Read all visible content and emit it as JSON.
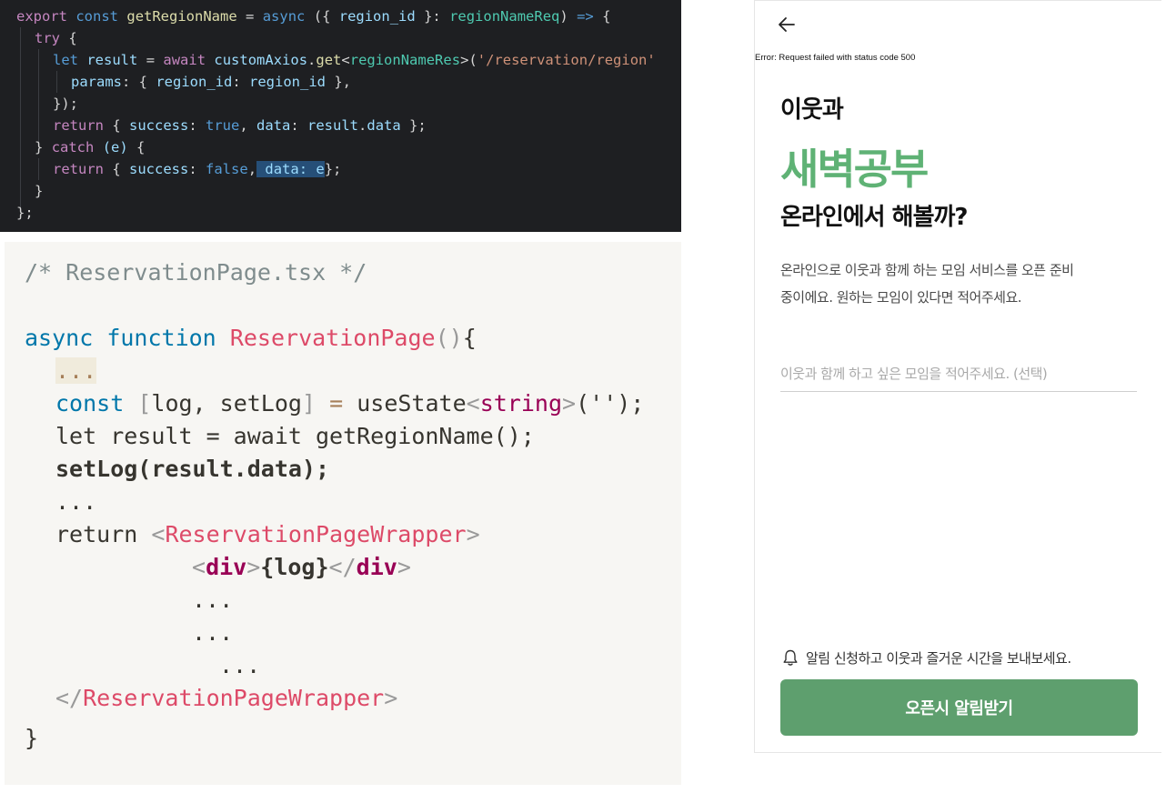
{
  "dark_editor": {
    "line1": {
      "kw_export": "export",
      "kw_const": "const",
      "fn_name": "getRegionName",
      "op_eq": "=",
      "kw_async": "async",
      "paren_open": "({ ",
      "param": "region_id",
      "brace_close": " }: ",
      "type_req": "regionNameReq",
      "paren_close": ")",
      "arrow": "=>",
      "brace": "{"
    },
    "line2": {
      "kw_try": "try",
      "brace": "{"
    },
    "line3": {
      "kw_let": "let",
      "var_result": "result",
      "op_eq": "=",
      "kw_await": "await",
      "obj": "customAxios",
      "dot": ".",
      "method": "get",
      "lt": "<",
      "type_res": "regionNameRes",
      "gt": ">",
      "paren": "(",
      "str": "'/reservation/region'"
    },
    "line4": {
      "key": "params",
      "colon": ": { ",
      "key2": "region_id",
      "colon2": ": ",
      "val": "region_id",
      "end": " },"
    },
    "line5": {
      "text": "});"
    },
    "line6": {
      "kw_return": "return",
      "open": "{ ",
      "key_success": "success",
      "colon": ": ",
      "bool_true": "true",
      "comma": ", ",
      "key_data": "data",
      "colon2": ": ",
      "obj": "result",
      "dot": ".",
      "prop": "data",
      "end": " };"
    },
    "line7": {
      "close": "}",
      "kw_catch": "catch",
      "param": "(e)",
      "brace": "{"
    },
    "line8": {
      "kw_return": "return",
      "open": "{ ",
      "key_success": "success",
      "colon": ": ",
      "bool_false": "false",
      "comma": ",",
      "sel_key": " data: ",
      "sel_val": "e",
      "end": "};"
    },
    "line9": {
      "text": "}"
    },
    "line10": {
      "text": "};"
    }
  },
  "light_code": {
    "comment": "/* ReservationPage.tsx */",
    "fn_line": {
      "kw_async": "async",
      "kw_function": "function",
      "name": "ReservationPage",
      "parens": "()",
      "brace": "{"
    },
    "ellipsis_1": "...",
    "state_line": {
      "kw_const": "const",
      "lb": "[",
      "ident": "log, setLog",
      "rb": "]",
      "op_eq": "=",
      "fn": "useState",
      "lt": "<",
      "type": "string",
      "gt": ">",
      "call": "(",
      "str": "''",
      "end": ");"
    },
    "let_line": "let result = await getRegionName();",
    "setlog_line": "setLog(result.data);",
    "ellipsis_2": "...",
    "return_line": {
      "kw_return": "return",
      "lt": "<",
      "tag": "ReservationPageWrapper",
      "gt": ">"
    },
    "div_line": {
      "lt": "<",
      "tag": "div",
      "gt": ">",
      "expr": "{log}",
      "lt_close": "</",
      "tag_close": "div",
      "gt_close": ">"
    },
    "ellipsis_3": "...",
    "ellipsis_4": "...",
    "ellipsis_5": "...",
    "close_tag_line": {
      "lt": "</",
      "tag": "ReservationPageWrapper",
      "gt": ">"
    },
    "close_brace": "}"
  },
  "phone": {
    "back_icon": "arrow-left-icon",
    "error_message": "Error: Request failed with status code 500",
    "headline_1": "이웃과",
    "headline_2": "새벽공부",
    "headline_3": "온라인에서 해볼까?",
    "description_line1": "온라인으로 이웃과 함께 하는 모임 서비스를 오픈 준비",
    "description_line2": "중이에요. 원하는 모임이 있다면 적어주세요.",
    "input_placeholder": "이웃과 함께 하고 싶은 모임을 적어주세요. (선택)",
    "bell_icon": "bell-icon",
    "notify_hint": "알림 신청하고 이웃과 즐거운 시간을 보내보세요.",
    "notify_button": "오픈시 알림받기",
    "colors": {
      "accent": "#5fb275",
      "button": "#5e9f6e"
    }
  }
}
